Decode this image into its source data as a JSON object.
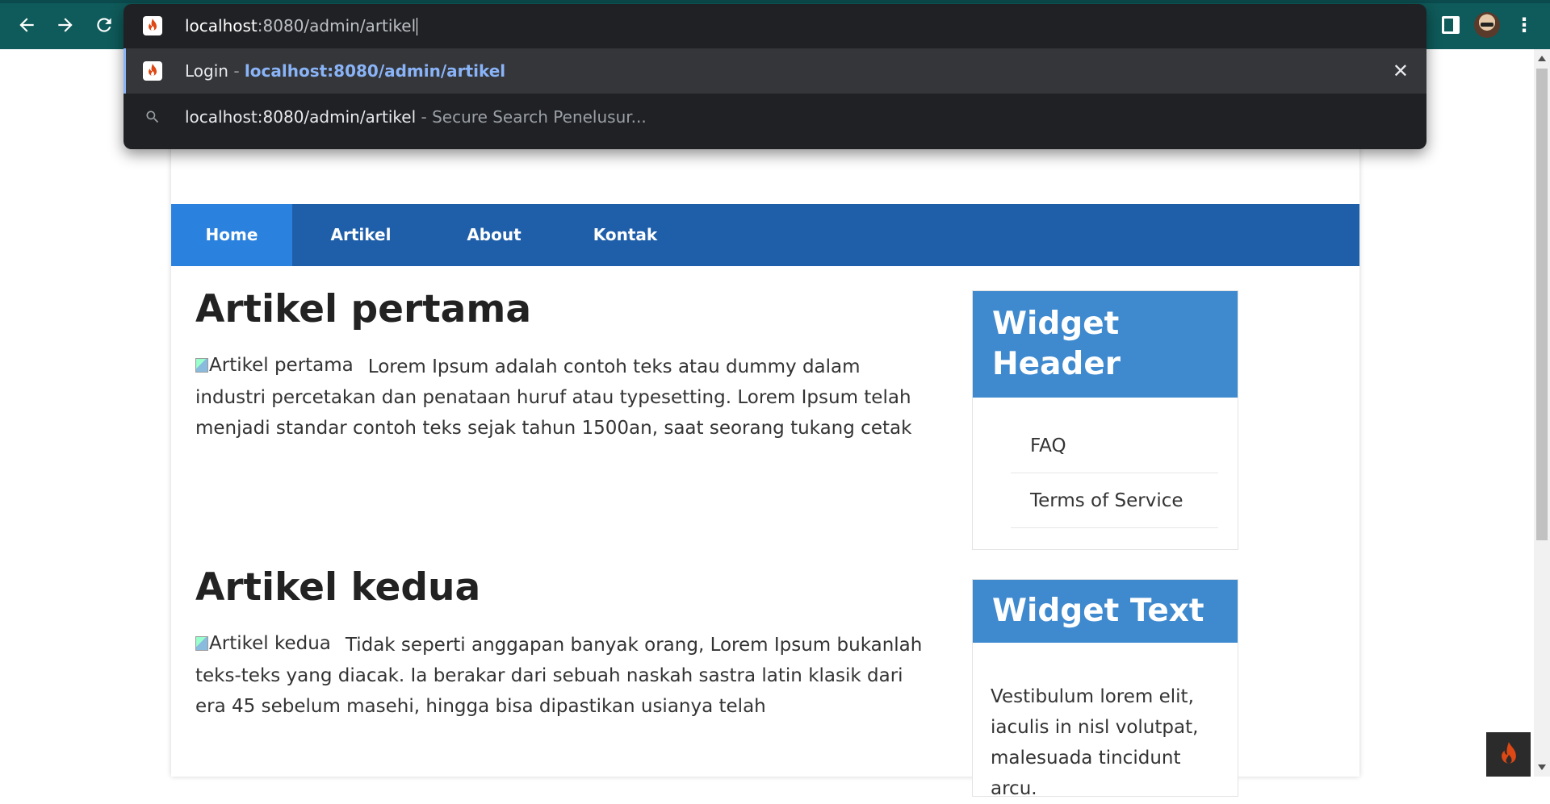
{
  "browser": {
    "back_icon": "arrow-left-icon",
    "forward_icon": "arrow-right-icon",
    "reload_icon": "reload-icon",
    "theme_color": "#0f5a5a"
  },
  "omnibox": {
    "input_host": "localhost",
    "input_path": ":8080/admin/artikel",
    "suggestions": [
      {
        "title": "Login",
        "separator": " - ",
        "url": "localhost:8080/admin/artikel",
        "icon": "codeigniter-flame-icon"
      },
      {
        "title": "localhost:8080/admin/artikel",
        "separator": " - ",
        "secondary": "Secure Search Penelusur...",
        "icon": "search-icon"
      }
    ],
    "remove_icon": "close-icon"
  },
  "nav": {
    "items": [
      {
        "label": "Home",
        "active": true
      },
      {
        "label": "Artikel"
      },
      {
        "label": "About"
      },
      {
        "label": "Kontak"
      }
    ],
    "color": "#1f5faa",
    "active_color": "#2b82de"
  },
  "articles": [
    {
      "title": "Artikel pertama",
      "img_alt": "Artikel pertama",
      "body": "Lorem Ipsum adalah contoh teks atau dummy dalam industri percetakan dan penataan huruf atau typesetting. Lorem Ipsum telah menjadi standar contoh teks sejak tahun 1500an, saat seorang tukang cetak"
    },
    {
      "title": "Artikel kedua",
      "img_alt": "Artikel kedua",
      "body": "Tidak seperti anggapan banyak orang, Lorem Ipsum bukanlah teks-teks yang diacak. Ia berakar dari sebuah naskah sastra latin klasik dari era 45 sebelum masehi, hingga bisa dipastikan usianya telah"
    }
  ],
  "sidebar": {
    "widget1": {
      "title": "Widget Header",
      "links": [
        "FAQ",
        "Terms of Service"
      ]
    },
    "widget2": {
      "title": "Widget Text",
      "text": "Vestibulum lorem elit, iaculis in nisl volutpat, malesuada tincidunt arcu."
    },
    "header_color": "#3f8ace"
  }
}
